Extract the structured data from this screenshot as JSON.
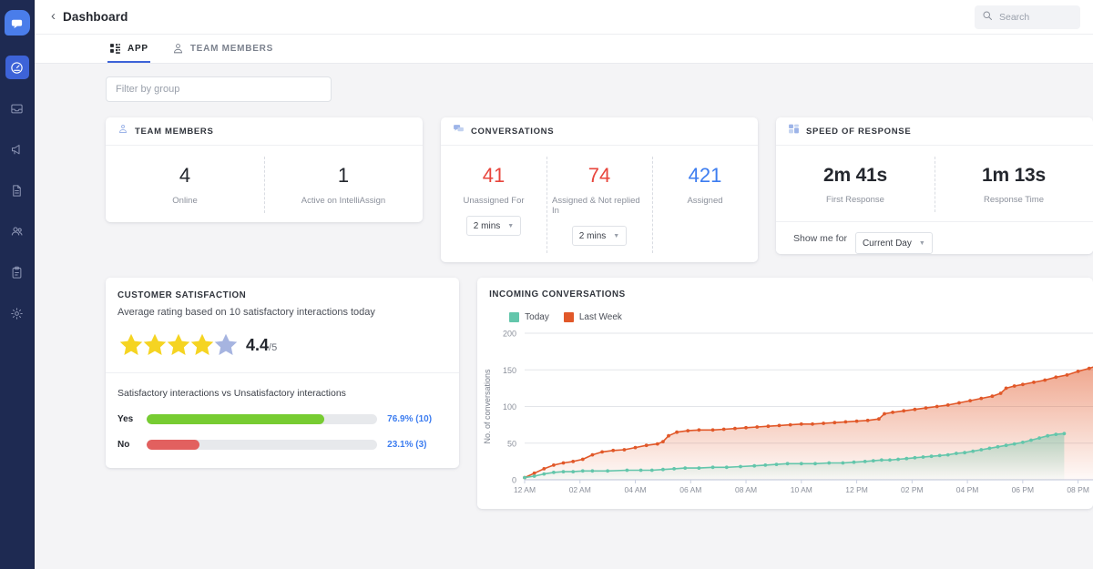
{
  "sidebar": {
    "logo_icon": "chat-bubble-logo",
    "items": [
      {
        "icon": "speedometer-icon",
        "name": "dashboard",
        "active": true
      },
      {
        "icon": "inbox-tray-icon",
        "name": "inbox",
        "active": false
      },
      {
        "icon": "megaphone-icon",
        "name": "campaigns",
        "active": false
      },
      {
        "icon": "document-icon",
        "name": "articles",
        "active": false
      },
      {
        "icon": "people-icon",
        "name": "contacts",
        "active": false
      },
      {
        "icon": "clipboard-icon",
        "name": "reports",
        "active": false
      },
      {
        "icon": "gear-icon",
        "name": "settings",
        "active": false
      }
    ]
  },
  "topbar": {
    "back_label": "‹",
    "title": "Dashboard",
    "search_placeholder": "Search",
    "search_value": "",
    "search_icon": "search-icon"
  },
  "tabs": [
    {
      "label": "APP",
      "icon": "grid-apps-icon",
      "active": true
    },
    {
      "label": "TEAM MEMBERS",
      "icon": "person-icon",
      "active": false
    }
  ],
  "filter": {
    "placeholder": "Filter by group",
    "value": ""
  },
  "team_members_card": {
    "title": "TEAM MEMBERS",
    "icon": "team-icon",
    "stats": [
      {
        "value": "4",
        "label": "Online"
      },
      {
        "value": "1",
        "label": "Active on IntelliAssign"
      }
    ]
  },
  "conversations_card": {
    "title": "CONVERSATIONS",
    "icon": "conversations-icon",
    "stats": [
      {
        "value": "41",
        "label": "Unassigned For",
        "color": "red",
        "select": "2 mins"
      },
      {
        "value": "74",
        "label": "Assigned & Not replied In",
        "color": "red",
        "select": "2 mins"
      },
      {
        "value": "421",
        "label": "Assigned",
        "color": "blue",
        "select": null
      }
    ]
  },
  "speed_card": {
    "title": "SPEED OF RESPONSE",
    "icon": "speed-icon",
    "stats": [
      {
        "value": "2m 41s",
        "label": "First Response"
      },
      {
        "value": "1m 13s",
        "label": "Response Time"
      }
    ],
    "footer_label": "Show me for",
    "footer_select": "Current Day"
  },
  "csat_card": {
    "title": "CUSTOMER SATISFACTION",
    "subtitle": "Average rating based on 10 satisfactory interactions today",
    "rating": "4.4",
    "rating_denominator": "/5",
    "stars_filled": 4,
    "stars_total": 5,
    "star_filled_color": "#f5d422",
    "star_empty_color": "#a6b4e0",
    "breakdown_title": "Satisfactory interactions vs Unsatisfactory interactions",
    "bars": [
      {
        "key": "Yes",
        "percent": 76.9,
        "value_label": "76.9% (10)",
        "color": "#77cc32"
      },
      {
        "key": "No",
        "percent": 23.1,
        "value_label": "23.1% (3)",
        "color": "#e2605f"
      }
    ]
  },
  "chart_card": {
    "title": "INCOMING CONVERSATIONS"
  },
  "chart_data": {
    "type": "area",
    "title": "INCOMING CONVERSATIONS",
    "xlabel": "",
    "ylabel": "No. of conversations",
    "ylim": [
      0,
      200
    ],
    "yticks": [
      0,
      50,
      100,
      150,
      200
    ],
    "xticks": [
      "12 AM",
      "02 AM",
      "04 AM",
      "06 AM",
      "08 AM",
      "10 AM",
      "12 PM",
      "02 PM",
      "04 PM",
      "06 PM",
      "08 PM"
    ],
    "x_hours": [
      0,
      2,
      4,
      6,
      8,
      10,
      12,
      14,
      16,
      18,
      20
    ],
    "xlim_hours": [
      0,
      21
    ],
    "grid": true,
    "legend_position": "top-left",
    "series": [
      {
        "name": "Today",
        "color": "#63c6ab",
        "x_hours": [
          0,
          0.35,
          0.7,
          1.05,
          1.4,
          1.75,
          2.1,
          2.45,
          3.0,
          3.7,
          4.2,
          4.6,
          5.0,
          5.4,
          5.8,
          6.3,
          6.8,
          7.3,
          7.8,
          8.3,
          8.7,
          9.1,
          9.5,
          10.0,
          10.5,
          11.0,
          11.5,
          11.9,
          12.3,
          12.6,
          12.9,
          13.2,
          13.5,
          13.8,
          14.1,
          14.4,
          14.7,
          15.0,
          15.3,
          15.6,
          15.9,
          16.2,
          16.5,
          16.8,
          17.1,
          17.4,
          17.7,
          18.0,
          18.3,
          18.6,
          18.9,
          19.2,
          19.5
        ],
        "values": [
          3,
          5,
          8,
          10,
          11,
          11,
          12,
          12,
          12,
          13,
          13,
          13,
          14,
          15,
          16,
          16,
          17,
          17,
          18,
          19,
          20,
          21,
          22,
          22,
          22,
          23,
          23,
          24,
          25,
          26,
          27,
          27,
          28,
          29,
          30,
          31,
          32,
          33,
          34,
          36,
          37,
          39,
          41,
          43,
          45,
          47,
          49,
          51,
          54,
          57,
          60,
          62,
          63
        ]
      },
      {
        "name": "Last Week",
        "color": "#e15829",
        "x_hours": [
          0,
          0.35,
          0.7,
          1.05,
          1.4,
          1.75,
          2.1,
          2.45,
          2.8,
          3.2,
          3.6,
          4.0,
          4.4,
          4.8,
          5.0,
          5.2,
          5.5,
          5.9,
          6.3,
          6.8,
          7.2,
          7.6,
          8.0,
          8.4,
          8.8,
          9.2,
          9.6,
          10.0,
          10.4,
          10.8,
          11.2,
          11.6,
          12.0,
          12.4,
          12.8,
          13.0,
          13.3,
          13.7,
          14.1,
          14.5,
          14.9,
          15.3,
          15.7,
          16.1,
          16.5,
          16.9,
          17.2,
          17.4,
          17.7,
          18.0,
          18.4,
          18.8,
          19.2,
          19.6,
          20.0,
          20.4,
          20.8,
          21.0
        ],
        "values": [
          3,
          9,
          15,
          20,
          23,
          25,
          28,
          34,
          38,
          40,
          41,
          44,
          47,
          49,
          52,
          60,
          65,
          67,
          68,
          68,
          69,
          70,
          71,
          72,
          73,
          74,
          75,
          76,
          76,
          77,
          78,
          79,
          80,
          81,
          83,
          90,
          92,
          94,
          96,
          98,
          100,
          102,
          105,
          108,
          111,
          114,
          118,
          125,
          128,
          130,
          133,
          136,
          140,
          143,
          148,
          152,
          157,
          162
        ]
      }
    ]
  }
}
